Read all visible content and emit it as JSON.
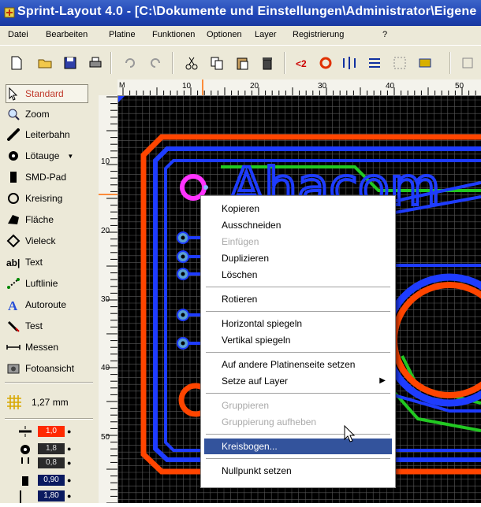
{
  "window": {
    "title": "Sprint-Layout 4.0 - [C:\\Dokumente und Einstellungen\\Administrator\\Eigene"
  },
  "menu": [
    "Datei",
    "Bearbeiten",
    "Platine",
    "Funktionen",
    "Optionen",
    "Layer",
    "Registrierung",
    "?"
  ],
  "toolbar": {
    "icons": [
      "new-file-icon",
      "open-folder-icon",
      "save-icon",
      "print-icon",
      "undo-icon",
      "redo-icon",
      "cut-icon",
      "copy-icon",
      "paste-icon",
      "delete-icon",
      "zoom-icon",
      "rotate-icon",
      "mirror-icon",
      "align-icon",
      "group-icon",
      "ungroup-icon",
      "more-icon"
    ]
  },
  "tools": [
    {
      "label": "Standard",
      "icon": "arrow-cursor-icon",
      "active": true
    },
    {
      "label": "Zoom",
      "icon": "magnifier-icon"
    },
    {
      "label": "Leiterbahn",
      "icon": "track-icon"
    },
    {
      "label": "Lötauge",
      "icon": "pad-icon",
      "has_dropdown": true
    },
    {
      "label": "SMD-Pad",
      "icon": "smd-pad-icon"
    },
    {
      "label": "Kreisring",
      "icon": "ring-icon"
    },
    {
      "label": "Fläche",
      "icon": "area-icon"
    },
    {
      "label": "Vieleck",
      "icon": "polygon-icon"
    },
    {
      "label": "Text",
      "icon": "text-icon"
    },
    {
      "label": "Luftlinie",
      "icon": "airwire-icon"
    },
    {
      "label": "Autoroute",
      "icon": "autoroute-icon"
    },
    {
      "label": "Test",
      "icon": "test-icon"
    },
    {
      "label": "Messen",
      "icon": "ruler-icon"
    },
    {
      "label": "Fotoansicht",
      "icon": "photo-icon"
    }
  ],
  "grid": {
    "value": "1,27 mm"
  },
  "params": [
    {
      "icon": "track-width-icon",
      "value": "1,0",
      "style": "red"
    },
    {
      "icon": "pad-size-icon",
      "value": "1,8",
      "style": "dark"
    },
    {
      "icon": "drill-icon",
      "value": "0,8",
      "style": "dark"
    },
    {
      "icon": "smd-size-icon",
      "value": "0,90",
      "style": "navy"
    },
    {
      "icon": "smd-height-icon",
      "value": "1,80",
      "style": "navy"
    }
  ],
  "ruler": {
    "h_marker": "M",
    "h_labels": [
      "10",
      "20",
      "30",
      "40",
      "50"
    ],
    "v_labels": [
      "10",
      "20",
      "30",
      "40",
      "50"
    ]
  },
  "board": {
    "text": "Ahacom",
    "colors": {
      "background": "#000000",
      "grid": "#5a5a5a",
      "copper_top": "#ff4500",
      "copper_bottom": "#1e3cff",
      "silk": "#22c822",
      "pad": "#ff33ff",
      "via": "#5aa0d0"
    }
  },
  "context_menu": {
    "items": [
      {
        "label": "Kopieren",
        "enabled": true
      },
      {
        "label": "Ausschneiden",
        "enabled": true
      },
      {
        "label": "Einfügen",
        "enabled": false
      },
      {
        "label": "Duplizieren",
        "enabled": true
      },
      {
        "label": "Löschen",
        "enabled": true
      },
      {
        "sep": true
      },
      {
        "label": "Rotieren",
        "enabled": true
      },
      {
        "sep": true
      },
      {
        "label": "Horizontal spiegeln",
        "enabled": true
      },
      {
        "label": "Vertikal spiegeln",
        "enabled": true
      },
      {
        "sep": true
      },
      {
        "label": "Auf andere Platinenseite setzen",
        "enabled": true
      },
      {
        "label": "Setze auf Layer",
        "enabled": true,
        "submenu": true
      },
      {
        "sep": true
      },
      {
        "label": "Gruppieren",
        "enabled": false
      },
      {
        "label": "Gruppierung aufheben",
        "enabled": false
      },
      {
        "sep": true
      },
      {
        "label": "Kreisbogen...",
        "enabled": true,
        "selected": true
      },
      {
        "sep": true
      },
      {
        "label": "Nullpunkt setzen",
        "enabled": true
      }
    ]
  }
}
